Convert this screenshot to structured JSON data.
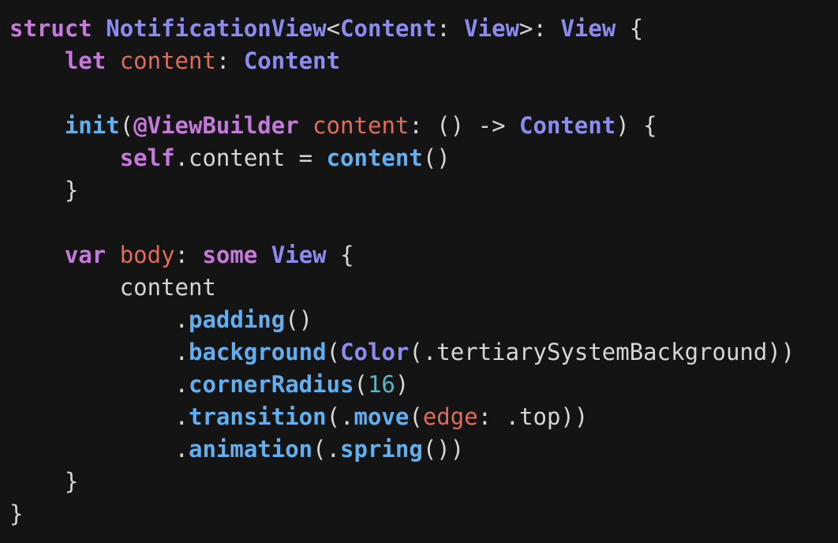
{
  "colors": {
    "background": "#141414",
    "keyword": "#c678dd",
    "type": "#8c8cf0",
    "function": "#61afef",
    "parameter": "#e06c5a",
    "number": "#56b6c2",
    "plain": "#d6d6d6"
  },
  "lines": [
    [
      {
        "k": "kw",
        "t": "struct"
      },
      {
        "k": "pln",
        "t": " "
      },
      {
        "k": "typ",
        "t": "NotificationView"
      },
      {
        "k": "pln",
        "t": "<"
      },
      {
        "k": "typ",
        "t": "Content"
      },
      {
        "k": "pln",
        "t": ": "
      },
      {
        "k": "typ",
        "t": "View"
      },
      {
        "k": "pln",
        "t": ">: "
      },
      {
        "k": "typ",
        "t": "View"
      },
      {
        "k": "pln",
        "t": " {"
      }
    ],
    [
      {
        "k": "pln",
        "t": "    "
      },
      {
        "k": "kw",
        "t": "let"
      },
      {
        "k": "pln",
        "t": " "
      },
      {
        "k": "prm",
        "t": "content"
      },
      {
        "k": "pln",
        "t": ": "
      },
      {
        "k": "typ",
        "t": "Content"
      }
    ],
    [],
    [
      {
        "k": "pln",
        "t": "    "
      },
      {
        "k": "fn",
        "t": "init"
      },
      {
        "k": "pln",
        "t": "("
      },
      {
        "k": "kw",
        "t": "@ViewBuilder"
      },
      {
        "k": "pln",
        "t": " "
      },
      {
        "k": "prm",
        "t": "content"
      },
      {
        "k": "pln",
        "t": ": () -> "
      },
      {
        "k": "typ",
        "t": "Content"
      },
      {
        "k": "pln",
        "t": ") {"
      }
    ],
    [
      {
        "k": "pln",
        "t": "        "
      },
      {
        "k": "kw",
        "t": "self"
      },
      {
        "k": "pln",
        "t": ".content = "
      },
      {
        "k": "fn",
        "t": "content"
      },
      {
        "k": "pln",
        "t": "()"
      }
    ],
    [
      {
        "k": "pln",
        "t": "    }"
      }
    ],
    [],
    [
      {
        "k": "pln",
        "t": "    "
      },
      {
        "k": "kw",
        "t": "var"
      },
      {
        "k": "pln",
        "t": " "
      },
      {
        "k": "prm",
        "t": "body"
      },
      {
        "k": "pln",
        "t": ": "
      },
      {
        "k": "kw",
        "t": "some"
      },
      {
        "k": "pln",
        "t": " "
      },
      {
        "k": "typ",
        "t": "View"
      },
      {
        "k": "pln",
        "t": " {"
      }
    ],
    [
      {
        "k": "pln",
        "t": "        content"
      }
    ],
    [
      {
        "k": "pln",
        "t": "            ."
      },
      {
        "k": "fn",
        "t": "padding"
      },
      {
        "k": "pln",
        "t": "()"
      }
    ],
    [
      {
        "k": "pln",
        "t": "            ."
      },
      {
        "k": "fn",
        "t": "background"
      },
      {
        "k": "pln",
        "t": "("
      },
      {
        "k": "typ",
        "t": "Color"
      },
      {
        "k": "pln",
        "t": "(.tertiarySystemBackground))"
      }
    ],
    [
      {
        "k": "pln",
        "t": "            ."
      },
      {
        "k": "fn",
        "t": "cornerRadius"
      },
      {
        "k": "pln",
        "t": "("
      },
      {
        "k": "num",
        "t": "16"
      },
      {
        "k": "pln",
        "t": ")"
      }
    ],
    [
      {
        "k": "pln",
        "t": "            ."
      },
      {
        "k": "fn",
        "t": "transition"
      },
      {
        "k": "pln",
        "t": "(."
      },
      {
        "k": "fn",
        "t": "move"
      },
      {
        "k": "pln",
        "t": "("
      },
      {
        "k": "prm",
        "t": "edge"
      },
      {
        "k": "pln",
        "t": ": .top))"
      }
    ],
    [
      {
        "k": "pln",
        "t": "            ."
      },
      {
        "k": "fn",
        "t": "animation"
      },
      {
        "k": "pln",
        "t": "(."
      },
      {
        "k": "fn",
        "t": "spring"
      },
      {
        "k": "pln",
        "t": "())"
      }
    ],
    [
      {
        "k": "pln",
        "t": "    }"
      }
    ],
    [
      {
        "k": "pln",
        "t": "}"
      }
    ]
  ]
}
